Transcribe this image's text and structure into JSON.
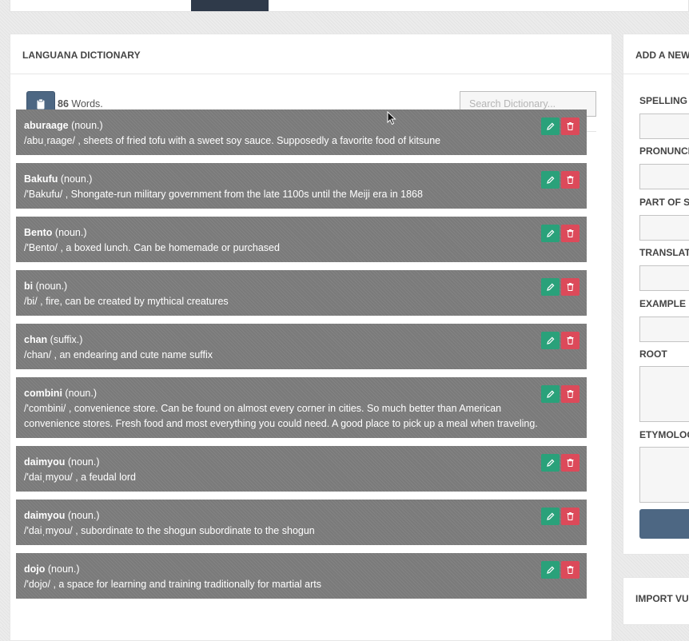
{
  "dictionary": {
    "title": "LANGUANA DICTIONARY",
    "count": "86",
    "count_suffix": " Words.",
    "search_placeholder": "Search Dictionary...",
    "entries": [
      {
        "word": "aburaage",
        "pos": "(noun.)",
        "definition": "/abuˌraage/ , sheets of fried tofu with a sweet soy sauce. Supposedly a favorite food of kitsune"
      },
      {
        "word": "Bakufu",
        "pos": "(noun.)",
        "definition": "/'Bakufu/ , Shongate-run military government from the late 1100s until the Meiji era in 1868"
      },
      {
        "word": "Bento",
        "pos": "(noun.)",
        "definition": "/'Bento/ , a boxed lunch. Can be homemade or purchased"
      },
      {
        "word": "bi",
        "pos": "(noun.)",
        "definition": "/bi/ , fire, can be created by mythical creatures"
      },
      {
        "word": "chan",
        "pos": "(suffix.)",
        "definition": "/chan/ , an endearing and cute name suffix"
      },
      {
        "word": "combini",
        "pos": "(noun.)",
        "definition": "/'combini/ , convenience store. Can be found on almost every corner in cities. So much better than American convenience stores. Fresh food and most everything you could need. A good place to pick up a meal when traveling."
      },
      {
        "word": "daimyou",
        "pos": "(noun.)",
        "definition": "/'daiˌmyou/ , a feudal lord"
      },
      {
        "word": "daimyou",
        "pos": "(noun.)",
        "definition": "/'daiˌmyou/ , subordinate to the shogun subordinate to the shogun"
      },
      {
        "word": "dojo",
        "pos": "(noun.)",
        "definition": "/'dojo/ , a space for learning and training traditionally for martial arts"
      }
    ]
  },
  "add_word": {
    "title": "ADD A NEW WORD",
    "labels": {
      "spelling": "SPELLING",
      "pronunciation": "PRONUNCIATION",
      "part_of_speech": "PART OF SPEECH",
      "translation": "TRANSLATION",
      "example": "EXAMPLE",
      "root": "ROOT",
      "etymology": "ETYMOLOGY"
    }
  },
  "import": {
    "title": "IMPORT VULGAR"
  },
  "colors": {
    "primary": "#4d6783",
    "edit": "#2aa17a",
    "delete": "#dc4a5a",
    "entry_bg": "#7a7a7a",
    "nav_active": "#2f3a4a"
  },
  "icons": {
    "clipboard": "clipboard-icon",
    "edit": "pencil-icon",
    "delete": "trash-icon"
  }
}
